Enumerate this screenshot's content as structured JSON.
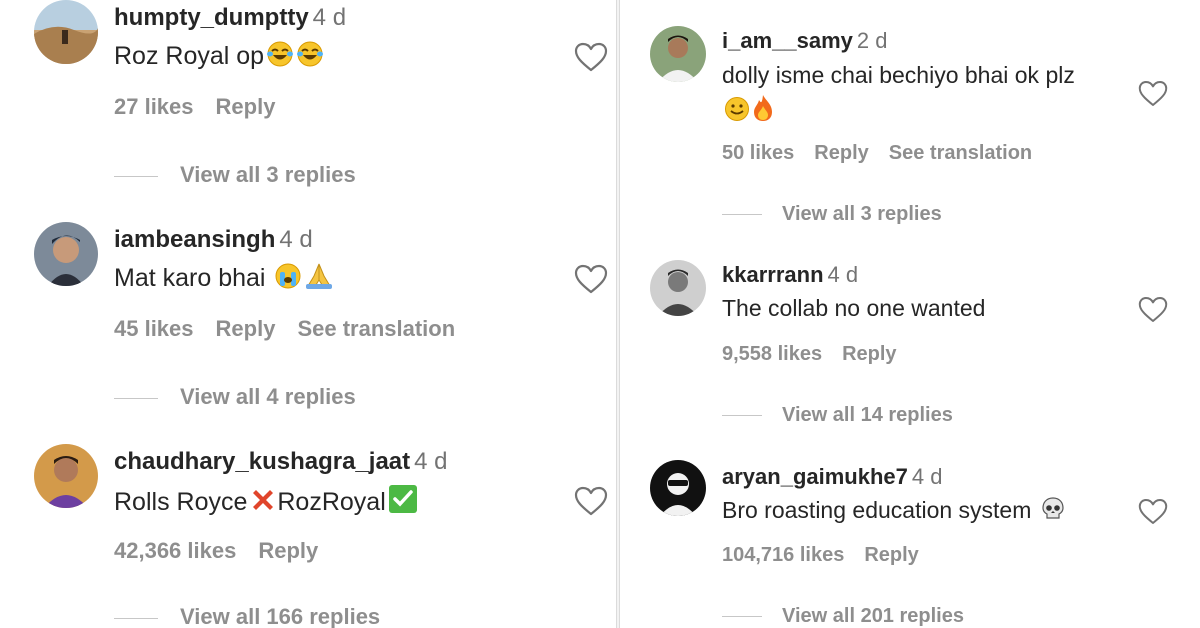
{
  "left_comments": [
    {
      "username": "humpty_dumptty",
      "time": "4 d",
      "text": "Roz Royal op",
      "emoji_icons": [
        "tears-of-joy-emoji",
        "tears-of-joy-emoji"
      ],
      "likes": "27 likes",
      "reply": "Reply",
      "translation": "",
      "view_replies": "View all 3 replies"
    },
    {
      "username": "iambeansingh",
      "time": "4 d",
      "text": "Mat karo bhai ",
      "emoji_icons": [
        "crying-face-emoji",
        "folded-hands-emoji"
      ],
      "likes": "45 likes",
      "reply": "Reply",
      "translation": "See translation",
      "view_replies": "View all 4 replies"
    },
    {
      "username": "chaudhary_kushagra_jaat",
      "time": "4 d",
      "text_parts": [
        "Rolls Royce",
        "RozRoyal"
      ],
      "emoji_icons": [
        "cross-mark-emoji",
        "check-mark-emoji"
      ],
      "likes": "42,366 likes",
      "reply": "Reply",
      "translation": "",
      "view_replies": "View all 166 replies"
    }
  ],
  "right_comments": [
    {
      "username": "i_am__samy",
      "time": "2 d",
      "text": "dolly isme chai bechiyo bhai ok plz",
      "emoji_icons": [
        "slightly-smiling-emoji",
        "fire-emoji"
      ],
      "likes": "50 likes",
      "reply": "Reply",
      "translation": "See translation",
      "view_replies": "View all 3 replies"
    },
    {
      "username": "kkarrrann",
      "time": "4 d",
      "text": "The collab no one wanted",
      "emoji_icons": [],
      "likes": "9,558 likes",
      "reply": "Reply",
      "translation": "",
      "view_replies": "View all 14 replies"
    },
    {
      "username": "aryan_gaimukhe7",
      "time": "4 d",
      "text": "Bro roasting education system ",
      "emoji_icons": [
        "skull-emoji"
      ],
      "likes": "104,716 likes",
      "reply": "Reply",
      "translation": "",
      "view_replies": "View all 201 replies"
    }
  ],
  "icons": {
    "like": "heart-outline-icon"
  },
  "colors": {
    "username": "#262626",
    "meta": "#8e8e8e",
    "time": "#737373",
    "divider": "#dbdbdb"
  }
}
